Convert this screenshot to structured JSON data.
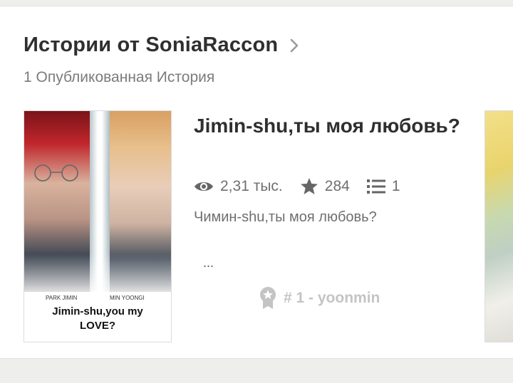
{
  "section": {
    "title": "Истории от SoniaRaccon",
    "subtitle": "1 Опубликованная История"
  },
  "story": {
    "title": "Jimin-shu,ты моя любовь?",
    "views": "2,31 тыс.",
    "votes": "284",
    "parts": "1",
    "description": "Чимин-shu,ты моя любовь?",
    "ellipsis": "...",
    "tag": "# 1 - yoonmin",
    "cover": {
      "left_name": "PARK JIMIN",
      "right_name": "MIN YOONGI",
      "title_line1": "Jimin-shu,you my",
      "title_line2": "LOVE?"
    }
  },
  "icons": {
    "chevron": "chevron-right-icon",
    "views": "eye-icon",
    "votes": "star-icon",
    "parts": "list-icon",
    "rank": "award-icon"
  },
  "colors": {
    "title": "#2f2f2f",
    "meta": "#6f6f6f",
    "tag": "#c4c4c4"
  }
}
